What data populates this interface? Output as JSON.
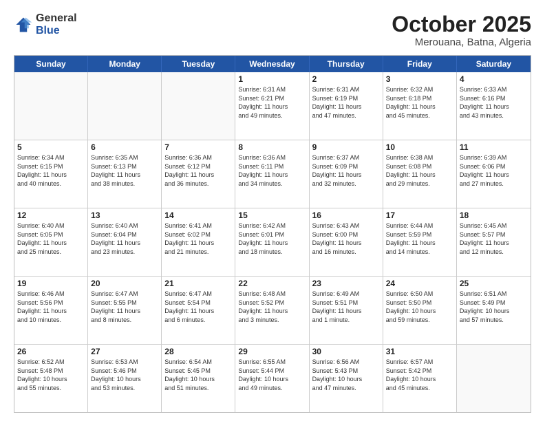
{
  "header": {
    "logo_general": "General",
    "logo_blue": "Blue",
    "month_title": "October 2025",
    "location": "Merouana, Batna, Algeria"
  },
  "weekdays": [
    "Sunday",
    "Monday",
    "Tuesday",
    "Wednesday",
    "Thursday",
    "Friday",
    "Saturday"
  ],
  "rows": [
    [
      {
        "day": "",
        "info": ""
      },
      {
        "day": "",
        "info": ""
      },
      {
        "day": "",
        "info": ""
      },
      {
        "day": "1",
        "info": "Sunrise: 6:31 AM\nSunset: 6:21 PM\nDaylight: 11 hours\nand 49 minutes."
      },
      {
        "day": "2",
        "info": "Sunrise: 6:31 AM\nSunset: 6:19 PM\nDaylight: 11 hours\nand 47 minutes."
      },
      {
        "day": "3",
        "info": "Sunrise: 6:32 AM\nSunset: 6:18 PM\nDaylight: 11 hours\nand 45 minutes."
      },
      {
        "day": "4",
        "info": "Sunrise: 6:33 AM\nSunset: 6:16 PM\nDaylight: 11 hours\nand 43 minutes."
      }
    ],
    [
      {
        "day": "5",
        "info": "Sunrise: 6:34 AM\nSunset: 6:15 PM\nDaylight: 11 hours\nand 40 minutes."
      },
      {
        "day": "6",
        "info": "Sunrise: 6:35 AM\nSunset: 6:13 PM\nDaylight: 11 hours\nand 38 minutes."
      },
      {
        "day": "7",
        "info": "Sunrise: 6:36 AM\nSunset: 6:12 PM\nDaylight: 11 hours\nand 36 minutes."
      },
      {
        "day": "8",
        "info": "Sunrise: 6:36 AM\nSunset: 6:11 PM\nDaylight: 11 hours\nand 34 minutes."
      },
      {
        "day": "9",
        "info": "Sunrise: 6:37 AM\nSunset: 6:09 PM\nDaylight: 11 hours\nand 32 minutes."
      },
      {
        "day": "10",
        "info": "Sunrise: 6:38 AM\nSunset: 6:08 PM\nDaylight: 11 hours\nand 29 minutes."
      },
      {
        "day": "11",
        "info": "Sunrise: 6:39 AM\nSunset: 6:06 PM\nDaylight: 11 hours\nand 27 minutes."
      }
    ],
    [
      {
        "day": "12",
        "info": "Sunrise: 6:40 AM\nSunset: 6:05 PM\nDaylight: 11 hours\nand 25 minutes."
      },
      {
        "day": "13",
        "info": "Sunrise: 6:40 AM\nSunset: 6:04 PM\nDaylight: 11 hours\nand 23 minutes."
      },
      {
        "day": "14",
        "info": "Sunrise: 6:41 AM\nSunset: 6:02 PM\nDaylight: 11 hours\nand 21 minutes."
      },
      {
        "day": "15",
        "info": "Sunrise: 6:42 AM\nSunset: 6:01 PM\nDaylight: 11 hours\nand 18 minutes."
      },
      {
        "day": "16",
        "info": "Sunrise: 6:43 AM\nSunset: 6:00 PM\nDaylight: 11 hours\nand 16 minutes."
      },
      {
        "day": "17",
        "info": "Sunrise: 6:44 AM\nSunset: 5:59 PM\nDaylight: 11 hours\nand 14 minutes."
      },
      {
        "day": "18",
        "info": "Sunrise: 6:45 AM\nSunset: 5:57 PM\nDaylight: 11 hours\nand 12 minutes."
      }
    ],
    [
      {
        "day": "19",
        "info": "Sunrise: 6:46 AM\nSunset: 5:56 PM\nDaylight: 11 hours\nand 10 minutes."
      },
      {
        "day": "20",
        "info": "Sunrise: 6:47 AM\nSunset: 5:55 PM\nDaylight: 11 hours\nand 8 minutes."
      },
      {
        "day": "21",
        "info": "Sunrise: 6:47 AM\nSunset: 5:54 PM\nDaylight: 11 hours\nand 6 minutes."
      },
      {
        "day": "22",
        "info": "Sunrise: 6:48 AM\nSunset: 5:52 PM\nDaylight: 11 hours\nand 3 minutes."
      },
      {
        "day": "23",
        "info": "Sunrise: 6:49 AM\nSunset: 5:51 PM\nDaylight: 11 hours\nand 1 minute."
      },
      {
        "day": "24",
        "info": "Sunrise: 6:50 AM\nSunset: 5:50 PM\nDaylight: 10 hours\nand 59 minutes."
      },
      {
        "day": "25",
        "info": "Sunrise: 6:51 AM\nSunset: 5:49 PM\nDaylight: 10 hours\nand 57 minutes."
      }
    ],
    [
      {
        "day": "26",
        "info": "Sunrise: 6:52 AM\nSunset: 5:48 PM\nDaylight: 10 hours\nand 55 minutes."
      },
      {
        "day": "27",
        "info": "Sunrise: 6:53 AM\nSunset: 5:46 PM\nDaylight: 10 hours\nand 53 minutes."
      },
      {
        "day": "28",
        "info": "Sunrise: 6:54 AM\nSunset: 5:45 PM\nDaylight: 10 hours\nand 51 minutes."
      },
      {
        "day": "29",
        "info": "Sunrise: 6:55 AM\nSunset: 5:44 PM\nDaylight: 10 hours\nand 49 minutes."
      },
      {
        "day": "30",
        "info": "Sunrise: 6:56 AM\nSunset: 5:43 PM\nDaylight: 10 hours\nand 47 minutes."
      },
      {
        "day": "31",
        "info": "Sunrise: 6:57 AM\nSunset: 5:42 PM\nDaylight: 10 hours\nand 45 minutes."
      },
      {
        "day": "",
        "info": ""
      }
    ]
  ]
}
